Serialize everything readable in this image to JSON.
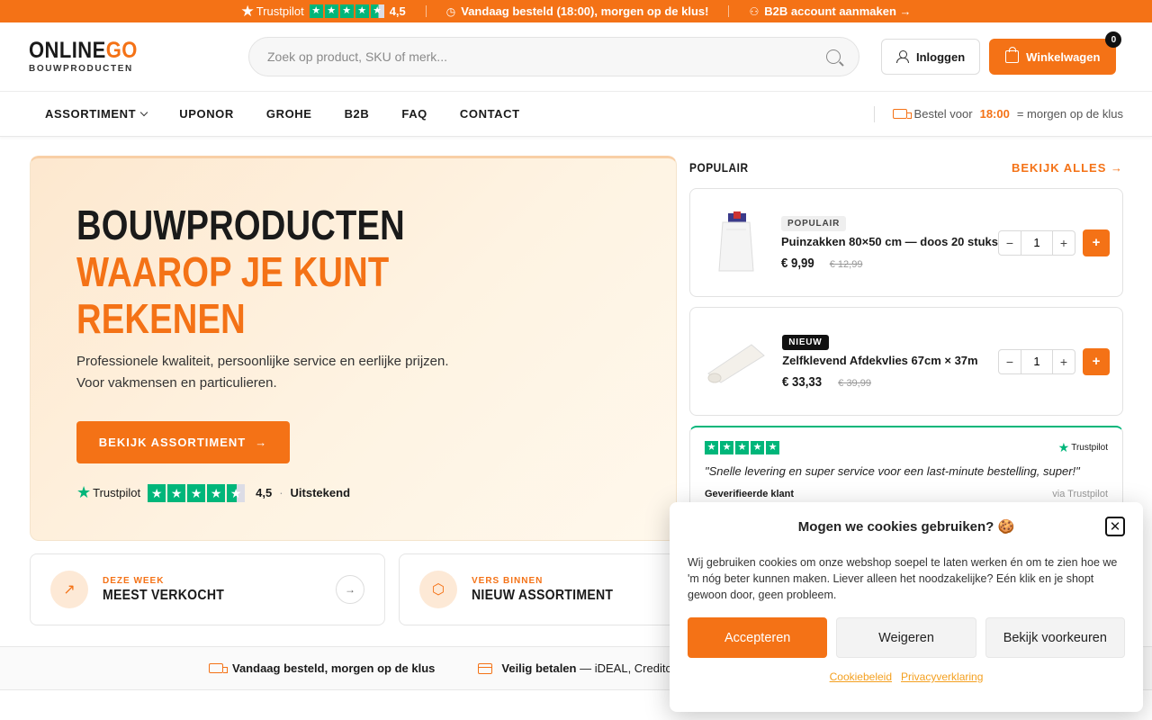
{
  "topbar": {
    "trustpilot_label": "Trustpilot",
    "rating": "4,5",
    "delivery_text": "Vandaag besteld (18:00), morgen op de klus!",
    "b2b_text": "B2B account aanmaken →"
  },
  "header": {
    "logo_main": "ONLINE",
    "logo_accent": "GO",
    "logo_sub": "BOUWPRODUCTEN",
    "search_placeholder": "Zoek op product, SKU of merk...",
    "login_label": "Inloggen",
    "cart_label": "Winkelwagen",
    "cart_count": "0"
  },
  "nav": {
    "items": [
      "ASSORTIMENT",
      "UPONOR",
      "GROHE",
      "B2B",
      "FAQ",
      "CONTACT"
    ],
    "delivery_prefix": "Bestel voor",
    "delivery_time": "18:00",
    "delivery_suffix": "= morgen op de klus"
  },
  "hero": {
    "line1": "BOUWPRODUCTEN",
    "line2": "WAAROP JE KUNT",
    "line3": "REKENEN",
    "text1": "Professionele kwaliteit, persoonlijke service en eerlijke prijzen.",
    "text2": "Voor vakmensen en particulieren.",
    "cta_label": "BEKIJK ASSORTIMENT",
    "tp_label": "Trustpilot",
    "tp_score": "4,5",
    "tp_sep": "·",
    "tp_verdict": "Uitstekend"
  },
  "features": [
    {
      "small": "DEZE WEEK",
      "big": "MEEST VERKOCHT"
    },
    {
      "small": "VERS BINNEN",
      "big": "NIEUW ASSORTIMENT"
    }
  ],
  "usp": {
    "u1": "Vandaag besteld, morgen op de klus",
    "u2_bold": "Veilig betalen",
    "u2_rest": "— iDEAL, Creditca"
  },
  "popular": {
    "title": "POPULAIR",
    "see_all": "BEKIJK ALLES →",
    "products": [
      {
        "badge": "POPULAIR",
        "name": "Puinzakken 80×50 cm — doos 20 stuks",
        "price": "€ 9,99",
        "old_price": "€ 12,99",
        "qty": "1"
      },
      {
        "badge": "NIEUW",
        "name": "Zelfklevend Afdekvlies 67cm × 37m",
        "price": "€ 33,33",
        "old_price": "€ 39,99",
        "qty": "1"
      }
    ]
  },
  "review": {
    "tp_label": "Trustpilot",
    "quote": "\"Snelle levering en super service voor een last-minute bestelling, super!\"",
    "author": "Geverifieerde klant",
    "via": "via Trustpilot"
  },
  "cookie": {
    "title": "Mogen we cookies gebruiken? 🍪",
    "text": "Wij gebruiken cookies om onze webshop soepel te laten werken én om te zien hoe we 'm nóg beter kunnen maken. Liever alleen het noodzakelijke? Eén klik en je shopt gewoon door, geen probleem.",
    "accept": "Accepteren",
    "decline": "Weigeren",
    "prefs": "Bekijk voorkeuren",
    "link1": "Cookiebeleid",
    "link2": "Privacyverklaring"
  },
  "colors": {
    "accent": "#f47216",
    "trustpilot": "#00b67a"
  }
}
